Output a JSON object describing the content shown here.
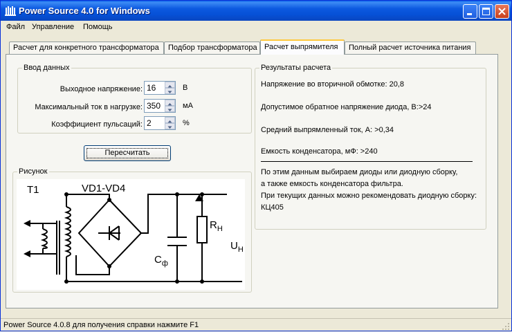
{
  "window": {
    "title": "Power Source 4.0 for Windows"
  },
  "menu": [
    "Файл",
    "Управление",
    "Помощь"
  ],
  "tabs": [
    {
      "label": "Расчет для конкретного трансформатора",
      "active": false
    },
    {
      "label": "Подбор трансформатора",
      "active": false
    },
    {
      "label": "Расчет выпрямителя",
      "active": true
    },
    {
      "label": "Полный расчет источника питания",
      "active": false
    }
  ],
  "input": {
    "title": "Ввод данных",
    "voltage": {
      "label": "Выходное напряжение:",
      "value": "16",
      "unit": "В"
    },
    "current": {
      "label": "Максимальный ток в нагрузке:",
      "value": "350",
      "unit": "мА"
    },
    "ripple": {
      "label": "Коэффициент пульсаций:",
      "value": "2",
      "unit": "%"
    }
  },
  "recalc_button": "Пересчитать",
  "drawing": {
    "title": "Рисунок",
    "t1": "T1",
    "vd": "VD1-VD4",
    "r": "R",
    "r_sub": "Н",
    "c": "С",
    "c_sub": "ф",
    "u": "U",
    "u_sub": "Н"
  },
  "results": {
    "title": "Результаты расчета",
    "secondary_voltage": "Напряжение во вторичной обмотке:   20,8",
    "reverse_voltage": "Допустимое обратное напряжение диода, В:>24",
    "avg_current": "Средний выпрямленный ток, А: >0,34",
    "capacitance": "Емкость конденсатора, мФ: >240",
    "note1": "По этим данным выбираем диоды или диодную сборку,",
    "note2": "а также емкость конденсатора фильтра.",
    "note3": "При текущих данных можно рекомендовать диодную сборку:",
    "recommendation": "КЦ405"
  },
  "status": "Power Source 4.0.8 для получения справки нажмите F1"
}
